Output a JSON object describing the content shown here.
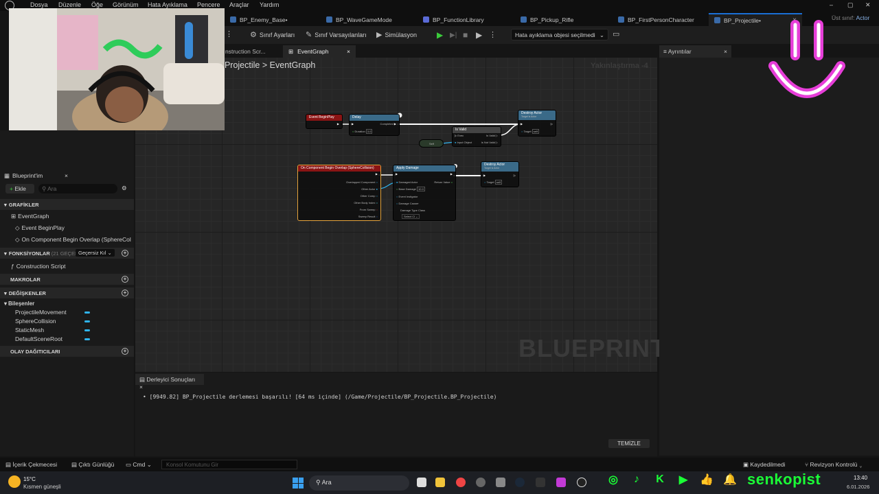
{
  "menubar": {
    "items": [
      "Dosya",
      "Düzenle",
      "Öğe",
      "Görünüm",
      "Hata Ayıklama",
      "Pencere",
      "Araçlar",
      "Yardım"
    ]
  },
  "tabs": [
    {
      "label": "BP_Enemy_Base•"
    },
    {
      "label": "BP_WaveGameMode"
    },
    {
      "label": "BP_FunctionLibrary"
    },
    {
      "label": "BP_Pickup_Rifle"
    },
    {
      "label": "BP_FirstPersonCharacter"
    },
    {
      "label": "BP_Projectile•"
    }
  ],
  "parent_class": {
    "label": "Üst sınıf:",
    "value": "Actor"
  },
  "toolbar": {
    "class_settings": "Sınıf Ayarları",
    "class_defaults": "Sınıf Varsayılanları",
    "simulation": "Simülasyon",
    "debug_object": "Hata ayıklama objesi seçilmedi"
  },
  "graph_tabs": [
    {
      "label": "nstruction Scr..."
    },
    {
      "label": "EventGraph"
    }
  ],
  "breadcrumb": {
    "parent": "_Projectile",
    "separator": ">",
    "current": "EventGraph"
  },
  "zoom_label": "Yakınlaştırma -4",
  "watermark": "BLUEPRINT",
  "details_tab": "Ayrıntılar",
  "my_blueprint": {
    "title": "Blueprint'im",
    "add_label": "Ekle",
    "search_placeholder": "Ara",
    "graphs_header": "GRAFİKLER",
    "event_graph": "EventGraph",
    "event_beginplay": "Event BeginPlay",
    "on_component_overlap": "On Component Begin Overlap (SphereCol",
    "functions_header": "FONKSİYONLAR",
    "functions_count": "(21 GEÇERSİ",
    "override_label": "Geçersiz Kıl",
    "construction_script": "Construction Script",
    "macros_header": "MAKROLAR",
    "variables_header": "DEĞİŞKENLER",
    "components_header": "Bileşenler",
    "components": [
      "ProjectileMovement",
      "SphereCollision",
      "StaticMesh",
      "DefaultSceneRoot"
    ],
    "dispatchers_header": "OLAY DAĞITICILARI"
  },
  "nodes": {
    "begin_play": "Event BeginPlay",
    "delay": "Delay",
    "delay_duration_pin": "Duration",
    "delay_duration_val": "3.0",
    "delay_completed": "Completed",
    "is_valid": "Is Valid",
    "is_valid_pin": "Input Object",
    "is_valid_out1": "Is Valid",
    "is_valid_out2": "Is Not Valid",
    "exec_pin": "Exec",
    "self_node": "Self",
    "destroy1": "Destroy Actor",
    "destroy_sub": "Target is Actor",
    "destroy_target": "Target",
    "destroy_self": "self",
    "overlap": "On Component Begin Overlap (SphereCollision)",
    "overlap_pins": [
      "Overlapped Component",
      "Other Actor",
      "Other Comp",
      "Other Body Index",
      "From Sweep",
      "Sweep Result"
    ],
    "apply_damage": "Apply Damage",
    "apply_pins": [
      "Damaged Actor",
      "Base Damage",
      "Event Instigator",
      "Damage Causer",
      "Damage Type Class"
    ],
    "apply_base_damage": "10.0",
    "apply_return": "Return Value",
    "apply_select": "Select Cl",
    "destroy2": "Destroy Actor"
  },
  "compiler": {
    "tab": "Derleyici Sonuçları",
    "message": "[9949.82] BP_Projectile derlemesi başarılı! [64 ms içinde] (/Game/Projectile/BP_Projectile.BP_Projectile)",
    "clear_button": "TEMİZLE"
  },
  "statusbar": {
    "content_drawer": "İçerik Çekmecesi",
    "output_log": "Çıktı Günlüğü",
    "cmd": "Cmd",
    "cmd_placeholder": "Konsol Komutunu Gir",
    "saved": "Kaydedilmedi",
    "revision": "Revizyon Kontrolü"
  },
  "taskbar": {
    "weather_temp": "15°C",
    "weather_desc": "Kısmen güneşli",
    "search": "Ara",
    "time": "13:40",
    "date": "6.01.2026"
  },
  "overlay": {
    "handle": "senkopist"
  },
  "colors": {
    "accent": "#1a6fd6",
    "pin_blue": "#2fb4ef",
    "brand_green": "#1aff36",
    "smile_pink": "#e63ed8"
  }
}
